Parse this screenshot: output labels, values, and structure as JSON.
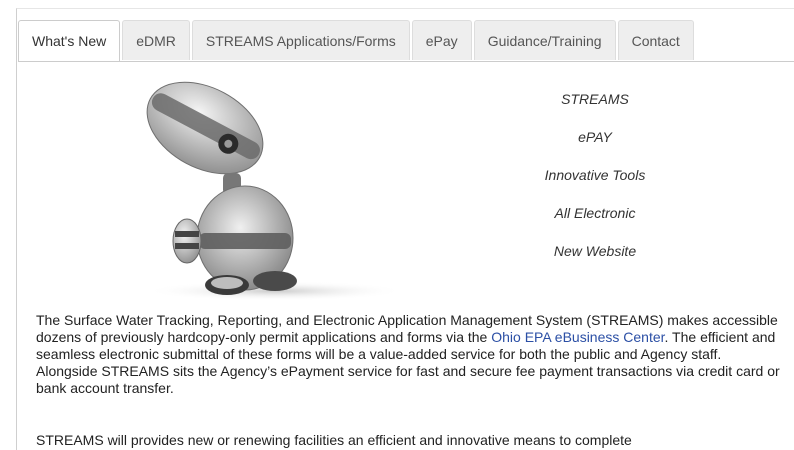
{
  "tabs": [
    {
      "label": "What's New",
      "active": true
    },
    {
      "label": "eDMR"
    },
    {
      "label": "STREAMS Applications/Forms"
    },
    {
      "label": "ePay"
    },
    {
      "label": "Guidance/Training"
    },
    {
      "label": "Contact"
    }
  ],
  "features": [
    "STREAMS",
    "ePAY",
    "Innovative Tools",
    "All Electronic",
    "New Website"
  ],
  "paragraph1": {
    "before_link": "The Surface Water Tracking, Reporting, and Electronic Application Management System (STREAMS) makes accessible dozens of previously hardcopy-only permit applications and forms via the ",
    "link": "Ohio EPA eBusiness Center",
    "after_link": ". The efficient and seamless electronic submittal of these forms will be a value-added service for both the public and Agency staff. Alongside STREAMS sits the Agency’s ePayment service for fast and secure fee payment transactions via credit card or bank account transfer."
  },
  "paragraph2": "STREAMS will provides new or renewing facilities an efficient and innovative means to complete",
  "colors": {
    "link": "#2b4fa5",
    "tab_bg": "#eeeeee",
    "robot_body": "#d9d9d9"
  },
  "hero_image": "robot-mascot-image"
}
